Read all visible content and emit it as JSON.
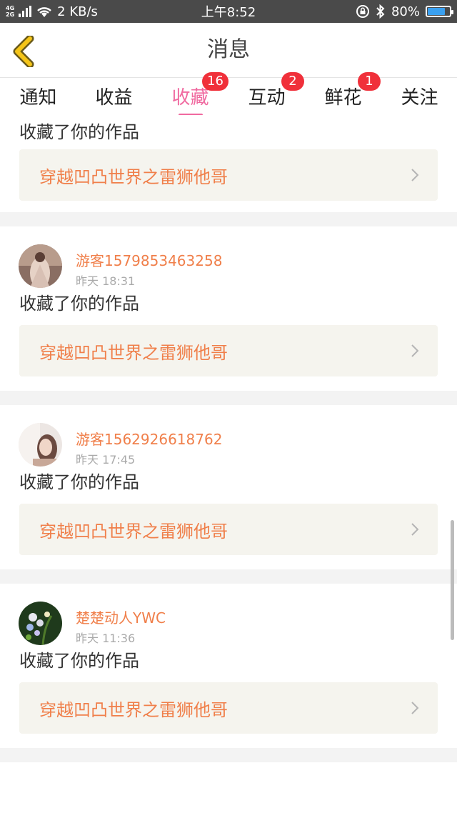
{
  "status_bar": {
    "network_top": "4G",
    "network_bottom": "2G",
    "speed": "2 KB/s",
    "time": "上午8:52",
    "battery_text": "80%",
    "battery_level": 0.8
  },
  "header": {
    "title": "消息",
    "back_icon": "chevron-left-icon"
  },
  "tabs": [
    {
      "label": "通知",
      "badge": null
    },
    {
      "label": "收益",
      "badge": null
    },
    {
      "label": "收藏",
      "badge": "16",
      "active": true
    },
    {
      "label": "互动",
      "badge": "2"
    },
    {
      "label": "鲜花",
      "badge": "1"
    },
    {
      "label": "关注",
      "badge": null
    }
  ],
  "first_item": {
    "action": "收藏了你的作品",
    "work": "穿越凹凸世界之雷狮他哥"
  },
  "items": [
    {
      "user": "游客1579853463258",
      "time": "昨天 18:31",
      "action": "收藏了你的作品",
      "work": "穿越凹凸世界之雷狮他哥"
    },
    {
      "user": "游客1562926618762",
      "time": "昨天 17:45",
      "action": "收藏了你的作品",
      "work": "穿越凹凸世界之雷狮他哥"
    },
    {
      "user": "楚楚动人YWC",
      "time": "昨天 11:36",
      "action": "收藏了你的作品",
      "work": "穿越凹凸世界之雷狮他哥"
    }
  ],
  "colors": {
    "accent_pink": "#f06aa0",
    "badge_red": "#f0303a",
    "name_orange": "#f07f4a",
    "back_yellow": "#f5c518"
  }
}
